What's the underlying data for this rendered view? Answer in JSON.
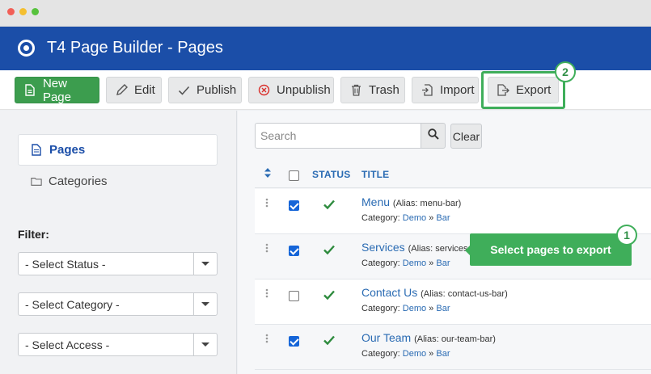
{
  "window": {
    "controls": [
      "close",
      "minimize",
      "maximize"
    ]
  },
  "header": {
    "title": "T4 Page Builder - Pages",
    "logo_icon": "target-icon"
  },
  "toolbar": {
    "new_page": "New Page",
    "edit": "Edit",
    "publish": "Publish",
    "unpublish": "Unpublish",
    "trash": "Trash",
    "import": "Import",
    "export": "Export"
  },
  "sidebar": {
    "items": [
      {
        "label": "Pages",
        "icon": "file-icon",
        "active": true
      },
      {
        "label": "Categories",
        "icon": "folder-icon",
        "active": false
      }
    ],
    "filter_label": "Filter:",
    "filters": [
      {
        "value": "- Select Status -"
      },
      {
        "value": "- Select Category -"
      },
      {
        "value": "- Select Access -"
      }
    ]
  },
  "search": {
    "placeholder": "Search",
    "clear_label": "Clear"
  },
  "table": {
    "columns": {
      "status": "STATUS",
      "title": "TITLE"
    },
    "rows": [
      {
        "title": "Menu",
        "alias": "(Alias: menu-bar)",
        "category_prefix": "Category:",
        "cat": "Demo",
        "sep": "»",
        "sub": "Bar",
        "checked": true,
        "published": true
      },
      {
        "title": "Services",
        "alias": "(Alias: services",
        "category_prefix": "Category:",
        "cat": "Demo",
        "sep": "»",
        "sub": "Bar",
        "checked": true,
        "published": true
      },
      {
        "title": "Contact Us",
        "alias": "(Alias: contact-us-bar)",
        "category_prefix": "Category:",
        "cat": "Demo",
        "sep": "»",
        "sub": "Bar",
        "checked": false,
        "published": true
      },
      {
        "title": "Our Team",
        "alias": "(Alias: our-team-bar)",
        "category_prefix": "Category:",
        "cat": "Demo",
        "sep": "»",
        "sub": "Bar",
        "checked": true,
        "published": true
      }
    ]
  },
  "annotations": {
    "step1_number": "1",
    "step1_text": "Select pages to export",
    "step2_number": "2"
  },
  "colors": {
    "brand_blue": "#1b4ea8",
    "accent_green": "#3fae5a",
    "link_blue": "#2a6bb3",
    "check_green": "#2e8b3e"
  }
}
